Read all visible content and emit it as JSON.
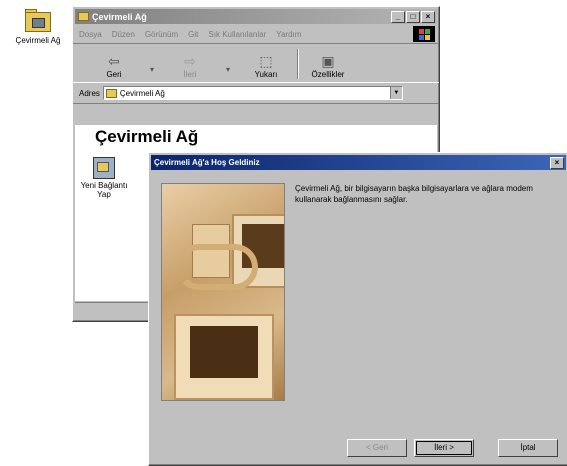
{
  "desktop": {
    "icon_label": "Çevirmeli Ağ"
  },
  "explorer": {
    "title": "Çevirmeli Ağ",
    "title_buttons": [
      "_",
      "□",
      "×"
    ],
    "menu": [
      "Dosya",
      "Düzen",
      "Görünüm",
      "Git",
      "Sık Kullanılanlar",
      "Yardım"
    ],
    "toolbar": {
      "back": "Geri",
      "forward": "İleri",
      "up": "Yukarı",
      "properties": "Özellikler"
    },
    "address_label": "Adres",
    "address_value": "Çevirmeli Ağ",
    "folder_title": "Çevirmeli Ağ",
    "items": [
      {
        "label": "Yeni Bağlantı Yap",
        "icon": "new-connection-icon"
      }
    ]
  },
  "wizard": {
    "title": "Çevirmeli Ağ'a Hoş Geldiniz",
    "body": "Çevirmeli Ağ, bir bilgisayarın başka bilgisayarlara ve ağlara modem kullanarak bağlanmasını sağlar.",
    "buttons": {
      "back": "< Geri",
      "next": "İleri >",
      "cancel": "İptal"
    }
  },
  "colors": {
    "title_active": "#0a246a",
    "title_inactive": "#808080",
    "face": "#c0c0c0"
  }
}
